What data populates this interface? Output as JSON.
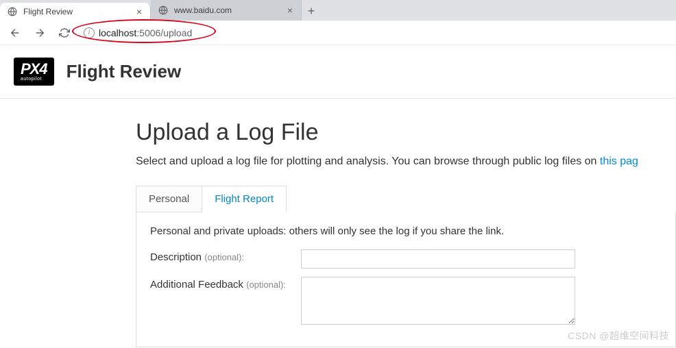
{
  "browser": {
    "tabs": [
      {
        "title": "Flight Review",
        "active": true
      },
      {
        "title": "www.baidu.com",
        "active": false
      }
    ],
    "url": {
      "host": "localhost",
      "rest": ":5006/upload"
    }
  },
  "header": {
    "logo_main": "PX4",
    "logo_sub": "autopilot",
    "title": "Flight Review"
  },
  "main": {
    "heading": "Upload a Log File",
    "subtext_pre": "Select and upload a log file for plotting and analysis. You can browse through public log files on ",
    "subtext_link": "this pag",
    "tabs": [
      {
        "label": "Personal",
        "active": false
      },
      {
        "label": "Flight Report",
        "active": true
      }
    ],
    "panel": {
      "note": "Personal and private uploads: others will only see the log if you share the link.",
      "fields": [
        {
          "label": "Description",
          "optional": "(optional):"
        },
        {
          "label": "Additional Feedback",
          "optional": "(optional):"
        }
      ]
    }
  },
  "watermark": "CSDN @超维空间科技"
}
